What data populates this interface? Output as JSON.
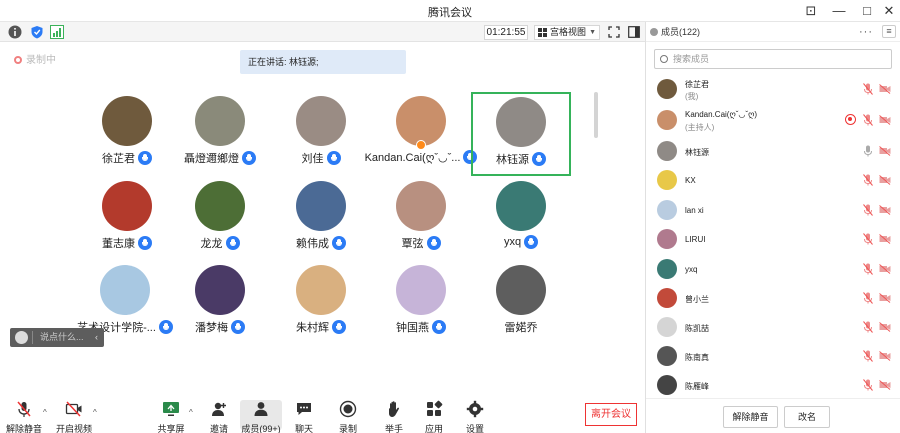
{
  "window": {
    "title": "腾讯会议",
    "minimize": "—",
    "maximize": "□",
    "close": "✕",
    "collapse": "⊡"
  },
  "topbar": {
    "timer": "01:21:55",
    "view_label": "宫格视图",
    "icons": [
      "info-icon",
      "shield-icon",
      "signal-icon",
      "fullscreen-icon",
      "sidebar-toggle-icon"
    ]
  },
  "recording": {
    "label": "录制中"
  },
  "speaking": {
    "text": "正在讲话: 林钰源;"
  },
  "participants": [
    {
      "name": "徐芷君",
      "color": "#6f5a3d"
    },
    {
      "name": "聶燈邇鄉燈",
      "color": "#8a8a7a"
    },
    {
      "name": "刘佳",
      "color": "#9a8c84"
    },
    {
      "name": "Kandan.Cai(ღˇ◡ˇ...",
      "color": "#c98f6a",
      "host": true
    },
    {
      "name": "林钰源",
      "color": "#8f8a86",
      "speaking": true
    },
    {
      "name": "董志康",
      "color": "#b33a2c"
    },
    {
      "name": "龙龙",
      "color": "#4d6e36"
    },
    {
      "name": "赖伟成",
      "color": "#4b6a95"
    },
    {
      "name": "覃弦",
      "color": "#b89080"
    },
    {
      "name": "yxq",
      "color": "#3a7a74"
    },
    {
      "name": "艺术设计学院-...",
      "color": "#a8c8e2"
    },
    {
      "name": "潘梦梅",
      "color": "#4a3a66"
    },
    {
      "name": "朱村辉",
      "color": "#d9b080"
    },
    {
      "name": "钟国燕",
      "color": "#c6b4d8"
    },
    {
      "name": "雷婼乔",
      "color": "#5e5e5e"
    }
  ],
  "chat": {
    "placeholder": "说点什么..."
  },
  "toolbar": {
    "unmute": "解除静音",
    "video": "开启视频",
    "share": "共享屏幕",
    "invite": "邀请",
    "members": "成员(99+)",
    "chat": "聊天",
    "record": "录制",
    "raise_hand": "举手",
    "apps": "应用",
    "settings": "设置",
    "leave": "离开会议"
  },
  "panel": {
    "title": "成员(122)",
    "more": "···",
    "menu": "≡",
    "search_placeholder": "搜索成员",
    "members": [
      {
        "name": "徐芷君",
        "sub": "(我)",
        "color": "#6f5a3d",
        "mic": "muted",
        "cam": "off"
      },
      {
        "name": "Kandan.Cai(ღˇ◡ˇღ)",
        "sub": "(主持人)",
        "color": "#c98f6a",
        "mic": "muted",
        "cam": "off",
        "rec": true
      },
      {
        "name": "林钰源",
        "sub": "",
        "color": "#8f8a86",
        "mic": "on",
        "cam": "off"
      },
      {
        "name": "KX",
        "sub": "",
        "color": "#e8c848",
        "mic": "muted",
        "cam": "off"
      },
      {
        "name": "lan xi",
        "sub": "",
        "color": "#b9cce0",
        "mic": "muted",
        "cam": "off"
      },
      {
        "name": "LIRUI",
        "sub": "",
        "color": "#b07a8e",
        "mic": "muted",
        "cam": "off"
      },
      {
        "name": "yxq",
        "sub": "",
        "color": "#3a7a74",
        "mic": "muted",
        "cam": "off"
      },
      {
        "name": "曾小兰",
        "sub": "",
        "color": "#c24a3a",
        "mic": "muted",
        "cam": "off"
      },
      {
        "name": "陈凯喆",
        "sub": "",
        "color": "#d5d5d5",
        "mic": "muted",
        "cam": "off"
      },
      {
        "name": "陈南真",
        "sub": "",
        "color": "#555555",
        "mic": "muted",
        "cam": "off"
      },
      {
        "name": "陈雁峰",
        "sub": "",
        "color": "#444444",
        "mic": "muted",
        "cam": "off"
      }
    ],
    "unmute_all": "解除静音",
    "rename": "改名"
  }
}
